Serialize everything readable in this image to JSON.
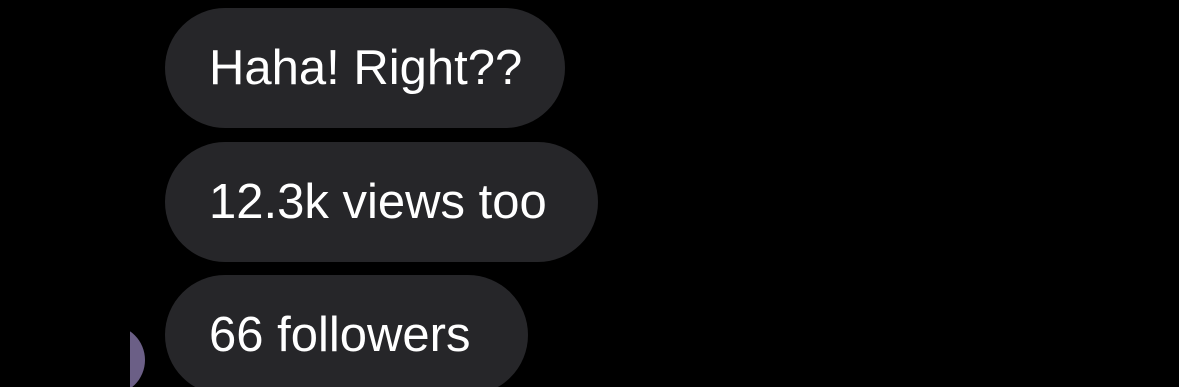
{
  "messages": [
    {
      "text": "Haha! Right??"
    },
    {
      "text": "12.3k views too"
    },
    {
      "text": "66 followers"
    }
  ],
  "colors": {
    "background": "#000000",
    "bubble": "#262629",
    "text": "#ffffff",
    "avatar": "#6b5f86"
  }
}
